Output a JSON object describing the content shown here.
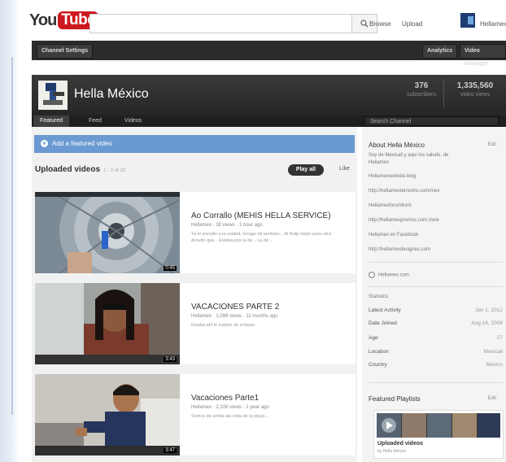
{
  "masthead": {
    "logo_you": "You",
    "logo_tube": "Tube",
    "search_icon": "search-icon",
    "browse": "Browse",
    "upload": "Upload",
    "username": "Hellamex"
  },
  "channel_bar": {
    "settings": "Channel Settings",
    "analytics": "Analytics",
    "video_manager": "Video Manager"
  },
  "channel": {
    "title": "Hella México",
    "subscribers": "376",
    "subscribers_label": "subscribers",
    "views": "1,335,560",
    "views_label": "video views",
    "tabs": [
      "Featured",
      "Feed",
      "Videos"
    ],
    "search_placeholder": "Search Channel"
  },
  "main": {
    "add_featured": "Add a featured video",
    "uploaded_title": "Uploaded videos",
    "uploaded_sub": "1 - 3 of 28",
    "play_all": "Play all",
    "like": "Like",
    "videos": [
      {
        "title": "Ao Corrallo (MEHIS HELLA SERVICE)",
        "meta": "Hellamex · 38 views · 1 hour ago",
        "desc": "Ya le prendio a la cuidad, recago tal tambien... Al Ratp mejor pues dice Arnulfo que... Estaba pos la de... La de...",
        "duration": "0:45"
      },
      {
        "title": "VACACIONES PARTE 2",
        "meta": "Hellamex · 1,098 views · 11 months ago",
        "desc": "Estaba ahí lo habían de enlazar...",
        "duration": "3:43"
      },
      {
        "title": "Vacaciones Parte1",
        "meta": "Hellamex · 2,106 views · 1 year ago",
        "desc": "Somos de arriba ala vista de la playa...",
        "duration": "3:47"
      }
    ]
  },
  "sidebar": {
    "about_title": "About Hella México",
    "edit": "Edit",
    "about_text": [
      "Soy de Mexicali y aqui los saludo, de",
      "Hellamex"
    ],
    "links": [
      "Hellamexwebsite.blog",
      "http://hellamexterrestre.com/mex",
      "Hellamexforumfront",
      "http://hellamexpromos.com.mx/e",
      "Hellamex en Facebook",
      "http://hellamexdesignes.com"
    ],
    "hellamex_label": "Hellamex.com",
    "statistics_label": "Statistics",
    "stats": [
      {
        "label": "Latest Activity",
        "value": "Jan 1, 2012"
      },
      {
        "label": "Date Joined",
        "value": "Aug 14, 2008"
      },
      {
        "label": "Age",
        "value": "27"
      },
      {
        "label": "Location",
        "value": "Mexicali"
      },
      {
        "label": "Country",
        "value": "Mexico"
      }
    ],
    "featured_playlists": "Featured Playlists",
    "playlist_title": "Uploaded videos",
    "playlist_sub": "by Hella México"
  }
}
